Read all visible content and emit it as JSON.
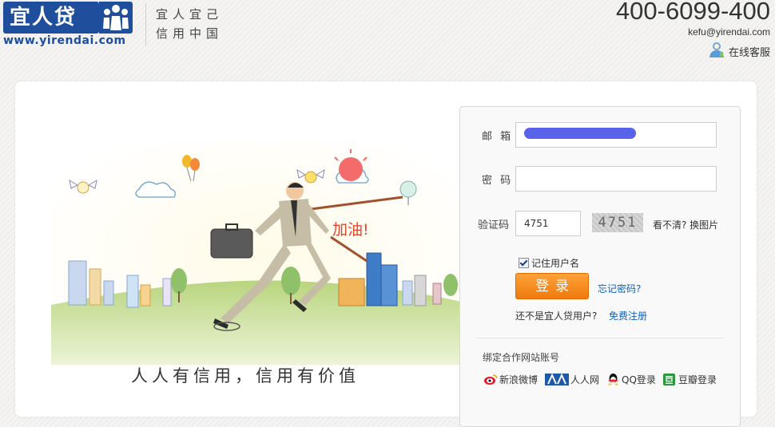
{
  "header": {
    "logo_text": "宜人贷",
    "logo_url": "www.yirendai.com",
    "slogan_line1": "宜人宜己",
    "slogan_line2": "信用中国",
    "phone": "400-6099-400",
    "email": "kefu@yirendai.com",
    "online_service": "在线客服"
  },
  "hero": {
    "bubble_text": "加油!",
    "tagline": "人人有信用，信用有价值"
  },
  "login": {
    "email_label": "邮  箱",
    "email_value": "",
    "password_label": "密  码",
    "password_value": "",
    "captcha_label": "验证码",
    "captcha_value": "4751",
    "captcha_image_text": "4751",
    "refresh_captcha": "看不清? 换图片",
    "remember_me": "记住用户名",
    "login_button": "登录",
    "forgot_password": "忘记密码?",
    "no_account": "还不是宜人贷用户?",
    "register": "免费注册",
    "bind_title": "绑定合作网站账号",
    "social_logins": [
      {
        "label": "新浪微博",
        "icon": "weibo-icon"
      },
      {
        "label": "人人网",
        "icon": "renren-icon"
      },
      {
        "label": "QQ登录",
        "icon": "qq-icon"
      },
      {
        "label": "豆瓣登录",
        "icon": "douban-icon"
      }
    ]
  },
  "colors": {
    "brand_blue": "#1f4e9c",
    "login_orange": "#f08a1c",
    "link_blue": "#1160b5"
  }
}
